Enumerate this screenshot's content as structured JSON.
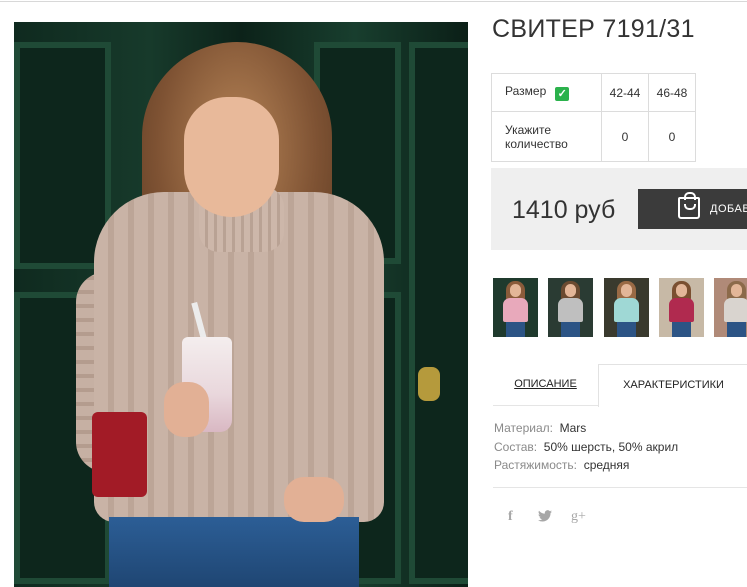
{
  "product": {
    "title": "СВИТЕР 7191/31"
  },
  "size_table": {
    "size_label": "Размер",
    "sizes": [
      "42-44",
      "46-48"
    ],
    "qty_label": "Укажите количество",
    "quantities": [
      "0",
      "0"
    ]
  },
  "price": {
    "value": "1410 руб"
  },
  "cart": {
    "button_label": "ДОБАВИТЬ"
  },
  "thumbnails": [
    {
      "sweater_color": "#e8a9bb",
      "bg_color": "#1f3a2d"
    },
    {
      "sweater_color": "#bfbfbf",
      "bg_color": "#2a3b33"
    },
    {
      "sweater_color": "#9fd8d5",
      "bg_color": "#3a3a2e"
    },
    {
      "sweater_color": "#b02a4f",
      "bg_color": "#c7b9a6"
    },
    {
      "sweater_color": "#d9d4cf",
      "bg_color": "#b08a78"
    }
  ],
  "tabs": {
    "description": "ОПИСАНИЕ",
    "characteristics": "ХАРАКТЕРИСТИКИ"
  },
  "specs": [
    {
      "key": "Материал:",
      "value": "Mars"
    },
    {
      "key": "Состав:",
      "value": "50% шерсть, 50% акрил"
    },
    {
      "key": "Растяжимость:",
      "value": "средняя"
    }
  ],
  "social": {
    "facebook": "f",
    "twitter": "🐦",
    "googleplus": "g+"
  },
  "colors": {
    "accent_check": "#2bb24c",
    "button_dark": "#3b3b3b",
    "price_bg": "#efefef"
  }
}
